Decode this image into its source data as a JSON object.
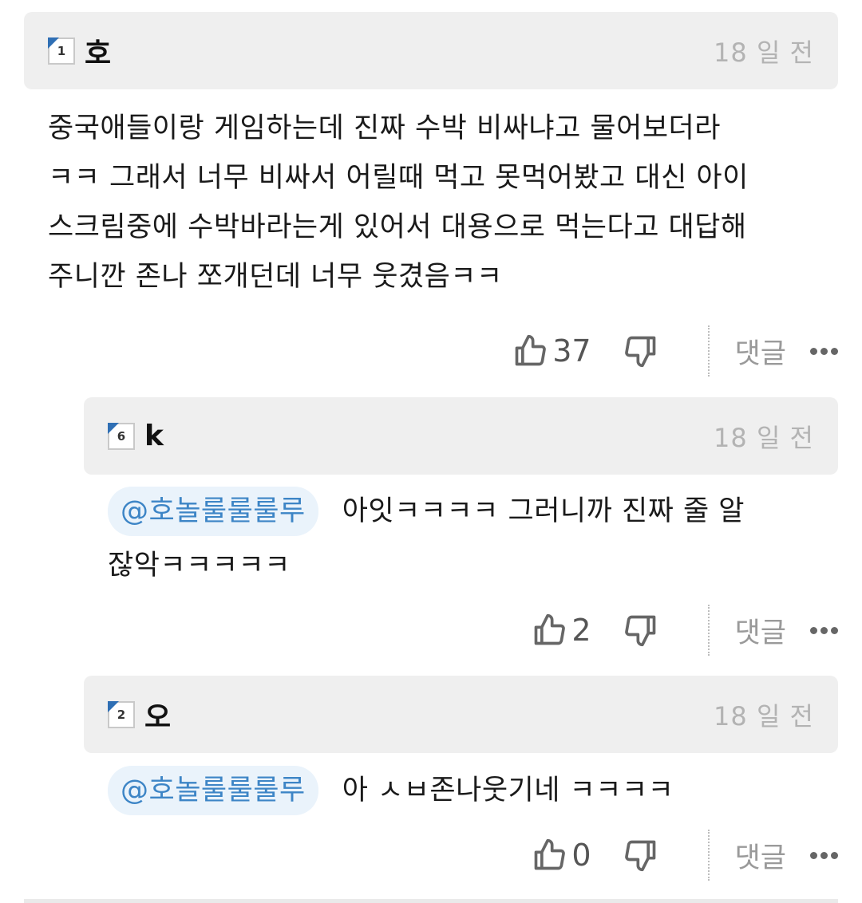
{
  "comments": [
    {
      "level": "1",
      "username": "호",
      "timestamp": "18 일 전",
      "lines": [
        "중국애들이랑 게임하는데 진짜 수박 비싸냐고 물어보더라",
        "ㅋㅋ 그래서 너무 비싸서 어릴때 먹고 못먹어봤고 대신 아이",
        "스크림중에 수박바라는게 있어서 대용으로 먹는다고 대답해",
        "주니깐 존나 쪼개던데 너무 웃겼음ㅋㅋ"
      ],
      "likes": "37",
      "reply_label": "댓글"
    },
    {
      "level": "6",
      "username": "k",
      "timestamp": "18 일 전",
      "mention": "@호놀룰룰룰루",
      "lines": [
        "아잇ㅋㅋㅋㅋ 그러니까 진짜 줄 알",
        "잖악ㅋㅋㅋㅋㅋ"
      ],
      "likes": "2",
      "reply_label": "댓글"
    },
    {
      "level": "2",
      "username": "오",
      "timestamp": "18 일 전",
      "mention": "@호놀룰룰룰루",
      "lines": [
        "아 ㅅㅂ존나웃기네 ㅋㅋㅋㅋ"
      ],
      "likes": "0",
      "reply_label": "댓글"
    }
  ],
  "icons": {
    "like": "thumbs-up-icon",
    "dislike": "thumbs-down-icon",
    "more": "more-dots-icon",
    "level": "level-badge-icon"
  },
  "colors": {
    "header_bg": "#efefef",
    "mention_bg": "#eaf3fb",
    "mention_text": "#3d85c6",
    "badge_accent": "#2f6fb4",
    "timestamp": "#b3b3b3"
  }
}
